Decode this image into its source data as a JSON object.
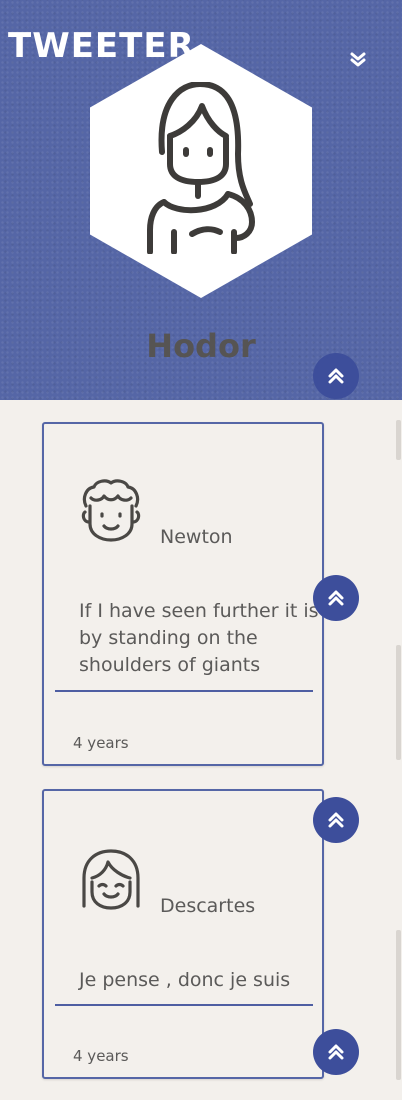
{
  "app": {
    "logo_text": "TWEETER"
  },
  "header": {
    "menu_icon": "double-chevron-down-icon",
    "profile_name": "Hodor",
    "avatar_icon": "woman-avatar-icon",
    "background_color": "#5566a6"
  },
  "tweets": [
    {
      "author": "Newton",
      "avatar_icon": "curly-hair-man-avatar-icon",
      "text": "If I have seen further it is by standing on the shoulders of giants",
      "time": "4 years"
    },
    {
      "author": "Descartes",
      "avatar_icon": "smiling-woman-avatar-icon",
      "text": "Je pense , donc je suis",
      "time": "4 years"
    }
  ],
  "fab_icon": "double-chevron-up-icon",
  "colors": {
    "accent": "#3d4e9b",
    "background": "#f3f0ec",
    "text": "#5b5a59",
    "card_border": "#5566a6"
  }
}
